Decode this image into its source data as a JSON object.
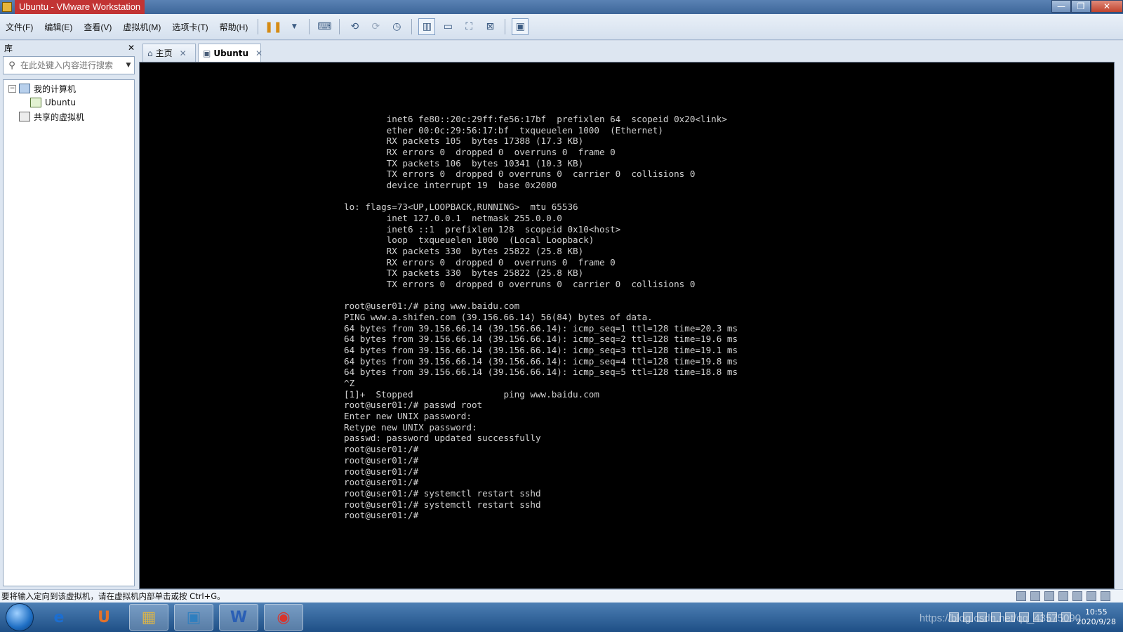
{
  "window": {
    "title": "Ubuntu - VMware Workstation"
  },
  "menu": [
    {
      "label": "文件(F)"
    },
    {
      "label": "编辑(E)"
    },
    {
      "label": "查看(V)"
    },
    {
      "label": "虚拟机(M)"
    },
    {
      "label": "选项卡(T)"
    },
    {
      "label": "帮助(H)"
    }
  ],
  "library": {
    "title": "库",
    "close": "✕",
    "search_placeholder": "在此处键入内容进行搜索",
    "tree": {
      "my_computer": "我的计算机",
      "ubuntu": "Ubuntu",
      "shared": "共享的虚拟机"
    }
  },
  "tabs": [
    {
      "label": "主页",
      "icon": "home-icon"
    },
    {
      "label": "Ubuntu",
      "icon": "vm-icon"
    }
  ],
  "terminal_lines": [
    "        inet6 fe80::20c:29ff:fe56:17bf  prefixlen 64  scopeid 0x20<link>",
    "        ether 00:0c:29:56:17:bf  txqueuelen 1000  (Ethernet)",
    "        RX packets 105  bytes 17388 (17.3 KB)",
    "        RX errors 0  dropped 0  overruns 0  frame 0",
    "        TX packets 106  bytes 10341 (10.3 KB)",
    "        TX errors 0  dropped 0 overruns 0  carrier 0  collisions 0",
    "        device interrupt 19  base 0x2000",
    "",
    "lo: flags=73<UP,LOOPBACK,RUNNING>  mtu 65536",
    "        inet 127.0.0.1  netmask 255.0.0.0",
    "        inet6 ::1  prefixlen 128  scopeid 0x10<host>",
    "        loop  txqueuelen 1000  (Local Loopback)",
    "        RX packets 330  bytes 25822 (25.8 KB)",
    "        RX errors 0  dropped 0  overruns 0  frame 0",
    "        TX packets 330  bytes 25822 (25.8 KB)",
    "        TX errors 0  dropped 0 overruns 0  carrier 0  collisions 0",
    "",
    "root@user01:/# ping www.baidu.com",
    "PING www.a.shifen.com (39.156.66.14) 56(84) bytes of data.",
    "64 bytes from 39.156.66.14 (39.156.66.14): icmp_seq=1 ttl=128 time=20.3 ms",
    "64 bytes from 39.156.66.14 (39.156.66.14): icmp_seq=2 ttl=128 time=19.6 ms",
    "64 bytes from 39.156.66.14 (39.156.66.14): icmp_seq=3 ttl=128 time=19.1 ms",
    "64 bytes from 39.156.66.14 (39.156.66.14): icmp_seq=4 ttl=128 time=19.8 ms",
    "64 bytes from 39.156.66.14 (39.156.66.14): icmp_seq=5 ttl=128 time=18.8 ms",
    "^Z",
    "[1]+  Stopped                 ping www.baidu.com",
    "root@user01:/# passwd root",
    "Enter new UNIX password:",
    "Retype new UNIX password:",
    "passwd: password updated successfully",
    "root@user01:/#",
    "root@user01:/#",
    "root@user01:/#",
    "root@user01:/#",
    "root@user01:/# systemctl restart sshd",
    "root@user01:/# systemctl restart sshd",
    "root@user01:/#"
  ],
  "status_bar": {
    "text": "要将输入定向到该虚拟机，请在虚拟机内部单击或按 Ctrl+G。"
  },
  "taskbar": {
    "items": [
      {
        "name": "ie-icon",
        "glyph": "e"
      },
      {
        "name": "browser-icon",
        "glyph": "U"
      },
      {
        "name": "explorer-icon",
        "glyph": "▦"
      },
      {
        "name": "vmware-icon",
        "glyph": "▣"
      },
      {
        "name": "word-icon",
        "glyph": "W"
      },
      {
        "name": "app-icon",
        "glyph": "◉"
      }
    ],
    "watermark": "https://blog.csdn.net/qq_43575090",
    "time": "10:55",
    "date": "2020/9/28"
  }
}
